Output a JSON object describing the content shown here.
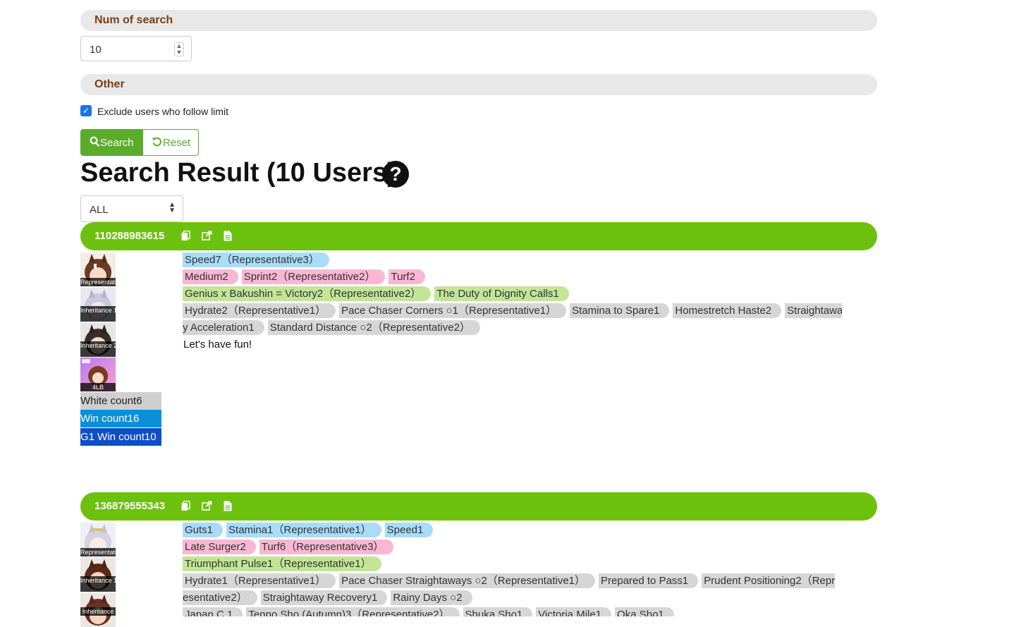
{
  "search": {
    "num_label": "Num of search",
    "num_value": "10",
    "other_label": "Other",
    "exclude_label": "Exclude users who follow limit",
    "search_label": "Search",
    "reset_label": "Reset"
  },
  "result": {
    "title": "Search Result (10 Users)",
    "filter_value": "ALL"
  },
  "users": [
    {
      "id": "110288983615",
      "avatars": [
        "Representative",
        "Inheritance 1",
        "Inheritance 2",
        "4LB"
      ],
      "white_count": "White count6",
      "win_count": "Win count16",
      "g1_win_count": "G1 Win count10",
      "blue_tags": [
        "Speed7（Representative3）"
      ],
      "pink_tags": [
        "Medium2",
        "Sprint2（Representative2）",
        "Turf2"
      ],
      "green_tags": [
        "Genius x Bakushin = Victory2（Representative2）",
        "The Duty of Dignity Calls1"
      ],
      "white_tags_1": [
        "Hydrate2（Representative1）",
        "Pace Chaser Corners ○1（Representative1）",
        "Stamina to Spare1",
        "Homestretch Haste2",
        "Straightawa"
      ],
      "white_tags_2": [
        "y Acceleration1",
        "Standard Distance ○2（Representative2）"
      ],
      "comment": "Let's have fun!"
    },
    {
      "id": "136879555343",
      "avatars": [
        "Representative",
        "Inheritance 1",
        "Inheritance"
      ],
      "blue_tags": [
        "Guts1",
        "Stamina1（Representative1）",
        "Speed1"
      ],
      "pink_tags": [
        "Late Surger2",
        "Turf6（Representative3）"
      ],
      "green_tags": [
        "Triumphant Pulse1（Representative1）"
      ],
      "white_tags_1": [
        "Hydrate1（Representative1）",
        "Pace Chaser Straightaways ○2（Representative1）",
        "Prepared to Pass1",
        "Prudent Positioning2（Repr"
      ],
      "white_tags_2": [
        "esentative2）",
        "Straightaway Recovery1",
        "Rainy Days ○2"
      ],
      "white_tags_3": [
        "Japan C.1",
        "Tenno Sho (Autumn)3（Representative2）",
        "Shuka Sho1",
        "Victoria Mile1",
        "Oka Sho1"
      ]
    }
  ],
  "colors": {
    "accent_green": "#6cc10e",
    "button_green": "#5aac2a",
    "section_label": "#7a3e10",
    "tag_blue": "#a8dcf8",
    "tag_pink": "#f9b7d4",
    "tag_green": "#c2e596",
    "tag_gray": "#d6d6d6",
    "win_blue": "#0a8fd8",
    "g1_blue": "#0d4fc7"
  },
  "icons": {
    "copy": "copy-icon",
    "external": "external-link-icon",
    "document": "document-icon",
    "search": "search-icon",
    "reset": "reset-icon",
    "help": "help-icon"
  }
}
